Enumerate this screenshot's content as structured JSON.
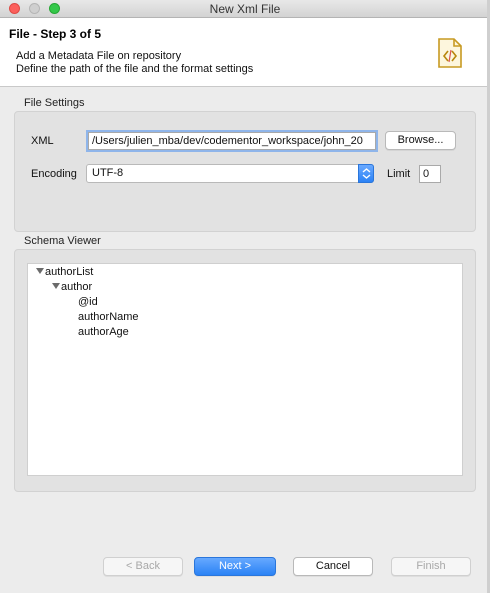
{
  "window": {
    "title": "New Xml File"
  },
  "header": {
    "step_title": "File - Step 3 of 5",
    "description_line1": "Add a Metadata File on repository",
    "description_line2": "Define the path of the file and the format settings",
    "icon": "xml-file-icon"
  },
  "file_settings": {
    "group_label": "File Settings",
    "xml_label": "XML",
    "xml_path": "/Users/julien_mba/dev/codementor_workspace/john_20",
    "browse_label": "Browse...",
    "encoding_label": "Encoding",
    "encoding_value": "UTF-8",
    "limit_label": "Limit",
    "limit_value": "0"
  },
  "schema_viewer": {
    "group_label": "Schema Viewer",
    "nodes": [
      "authorList",
      "author",
      "@id",
      "authorName",
      "authorAge"
    ]
  },
  "buttons": {
    "back": "< Back",
    "next": "Next >",
    "cancel": "Cancel",
    "finish": "Finish"
  },
  "colors": {
    "accent": "#2a82f5",
    "close": "#fc605c",
    "maximize": "#34c84a"
  }
}
